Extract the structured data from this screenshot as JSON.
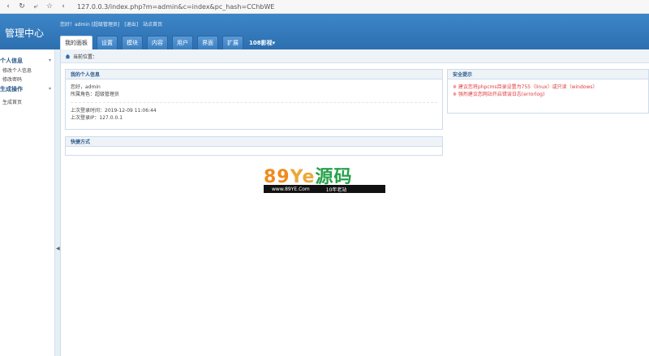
{
  "browser": {
    "back_icon": "back-icon",
    "refresh_icon": "refresh-icon",
    "url": "127.0.0.3/index.php?m=admin&c=index&pc_hash=CChbWE"
  },
  "header": {
    "title": "管理中心",
    "greeting": "您好！admin [超级管理员]",
    "logout": "[退出]",
    "site_home": "站点首页",
    "tabs": [
      "我的面板",
      "设置",
      "模块",
      "内容",
      "用户",
      "界面",
      "扩展"
    ],
    "tab_more": "108影视▾"
  },
  "sidebar": {
    "groups": [
      {
        "title": "个人信息",
        "items": [
          "修改个人信息",
          "修改密码"
        ]
      },
      {
        "title": "生成操作",
        "items": [
          "生成首页"
        ]
      }
    ]
  },
  "breadcrumb": {
    "label": "当前位置："
  },
  "personal_panel": {
    "title": "我的个人信息",
    "hello": "您好，admin",
    "role": "所属角色：超级管理员",
    "last_login_time": "上次登录时间：2019-12-09 11:06:44",
    "last_login_ip": "上次登录IP：127.0.0.1"
  },
  "shortcut_panel": {
    "title": "快捷方式"
  },
  "security_panel": {
    "title": "安全提示",
    "warnings": [
      "※ 建议您将phpcms目录设置为755（linux）或只读（windows）",
      "※ 强烈建议您网站开启错误日志(errorlog)"
    ]
  },
  "watermark": {
    "brand_a": "89",
    "brand_b": "Ye",
    "brand_c": "源码",
    "url": "www.89YE.Com",
    "slogan": "10年老站"
  },
  "colors": {
    "header": "#2d6fb0",
    "accent": "#3c86c8",
    "warning": "#e03b3b"
  }
}
